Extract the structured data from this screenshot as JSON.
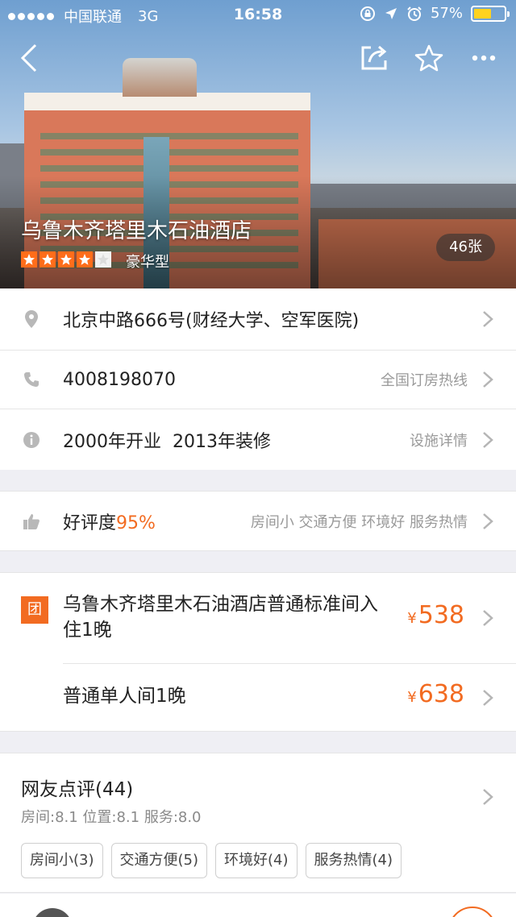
{
  "status_bar": {
    "carrier": "中国联通",
    "network": "3G",
    "time": "16:58",
    "battery_percent": "57%",
    "battery_level": 0.57
  },
  "hotel": {
    "name": "乌鲁木齐塔里木石油酒店",
    "star_rating": 4,
    "type": "豪华型",
    "photo_count": "46张"
  },
  "info_rows": {
    "address": "北京中路666号(财经大学、空军医院)",
    "phone": "4008198070",
    "phone_hint": "全国订房热线",
    "history": "2000年开业  2013年装修",
    "history_hint": "设施详情"
  },
  "rating": {
    "label": "好评度",
    "value": "95%",
    "tags_summary": "房间小 交通方便 环境好 服务热情"
  },
  "deals": {
    "badge": "团",
    "currency": "¥",
    "items": [
      {
        "title": "乌鲁木齐塔里木石油酒店普通标准间入住1晚",
        "price": "538"
      },
      {
        "title": "普通单人间1晚",
        "price": "638"
      }
    ]
  },
  "reviews": {
    "title": "网友点评(44)",
    "scores": "房间:8.1 位置:8.1 服务:8.0",
    "tags": [
      "房间小(3)",
      "交通方便(5)",
      "环境好(4)",
      "服务热情(4)"
    ]
  },
  "colors": {
    "accent": "#f26b21",
    "star": "#ff6d1a",
    "battery": "#ffd21f"
  }
}
